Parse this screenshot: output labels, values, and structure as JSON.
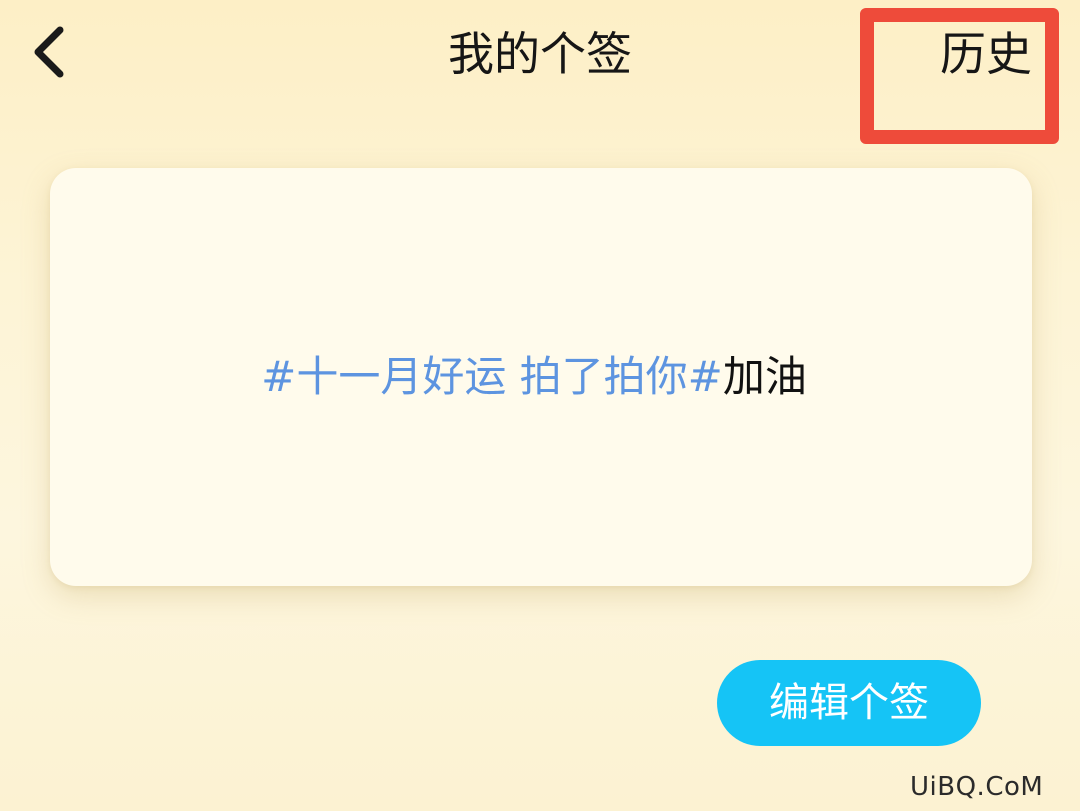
{
  "header": {
    "back_icon": "chevron-left-icon",
    "title": "我的个签",
    "history_label": "历史"
  },
  "signature": {
    "topic": "#十一月好运 拍了拍你#",
    "text": "加油"
  },
  "actions": {
    "edit_label": "编辑个签"
  },
  "watermark": "UiBQ.CoM",
  "colors": {
    "background": "#fdf2d4",
    "card": "#fffbec",
    "topic_link": "#5d94e0",
    "edit_button": "#15c4f6",
    "highlight_box": "#ee4b3a"
  }
}
